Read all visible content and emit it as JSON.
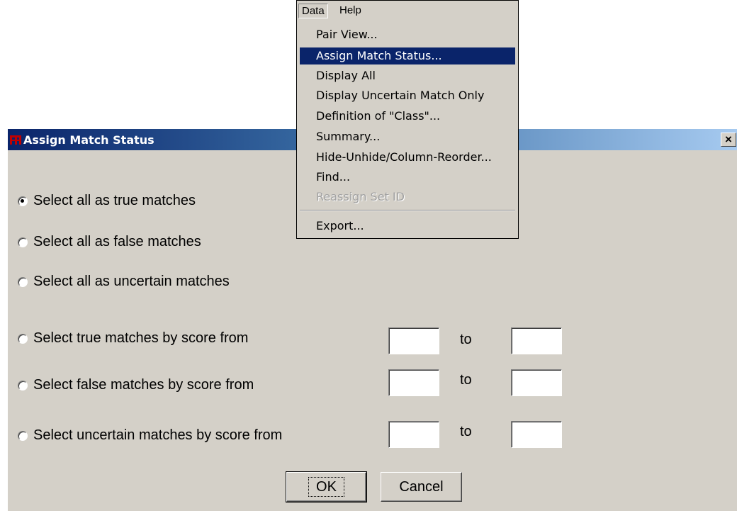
{
  "dialog": {
    "title": "Assign Match Status",
    "close_label": "×"
  },
  "options": [
    {
      "label": "Select all as true matches",
      "checked": true
    },
    {
      "label": "Select all as false matches",
      "checked": false
    },
    {
      "label": "Select all as uncertain matches",
      "checked": false
    },
    {
      "label": "Select true matches by score from",
      "checked": false
    },
    {
      "label": "Select false matches  by score from",
      "checked": false
    },
    {
      "label": "Select uncertain matches  by score from",
      "checked": false
    }
  ],
  "range": {
    "to_label": "to",
    "from_values": [
      "",
      "",
      ""
    ],
    "to_values": [
      "",
      "",
      ""
    ]
  },
  "buttons": {
    "ok": "OK",
    "cancel": "Cancel"
  },
  "menubar": {
    "data": "Data",
    "help": "Help"
  },
  "menu": {
    "items": [
      "Pair View...",
      "Assign Match Status...",
      "Display All",
      "Display Uncertain Match Only",
      "Definition of \"Class\"...",
      "Summary...",
      "Hide-Unhide/Column-Reorder...",
      "Find...",
      "Reassign Set ID",
      "Export..."
    ],
    "highlighted": "Assign Match Status...",
    "disabled": "Reassign Set ID"
  },
  "colors": {
    "face": "#d4d0c8",
    "title_start": "#0a246a",
    "title_end": "#a6caf0",
    "highlight": "#0a246a"
  }
}
